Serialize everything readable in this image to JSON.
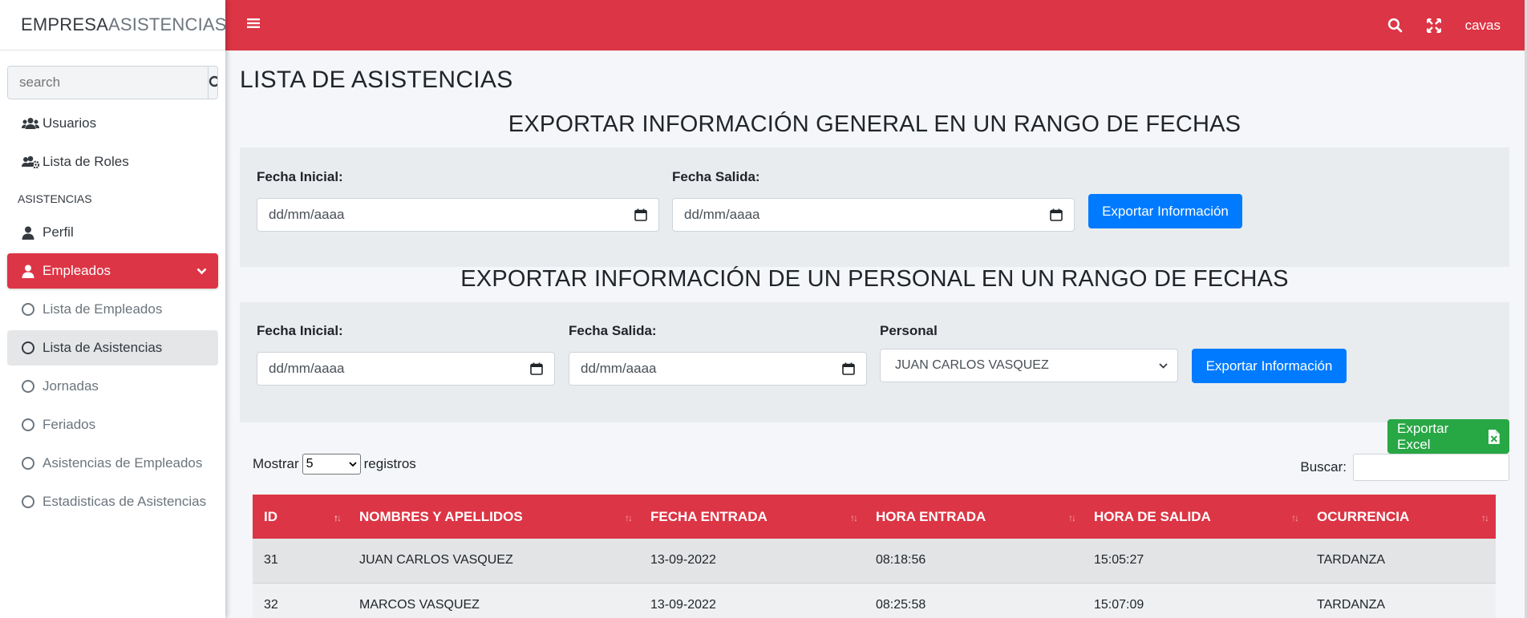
{
  "brand": {
    "bold": "EMPRESA",
    "light": "ASISTENCIAS"
  },
  "sidebar": {
    "search_placeholder": "search",
    "items": [
      {
        "label": "Usuarios",
        "icon": "users-icon"
      },
      {
        "label": "Lista de Roles",
        "icon": "users-cog-icon"
      }
    ],
    "section_header": "ASISTENCIAS",
    "perfil": {
      "label": "Perfil",
      "icon": "user-icon"
    },
    "empleados": {
      "label": "Empleados",
      "icon": "user-icon"
    },
    "subitems": [
      {
        "label": "Lista de Empleados"
      },
      {
        "label": "Lista de Asistencias"
      },
      {
        "label": "Jornadas"
      },
      {
        "label": "Feriados"
      },
      {
        "label": "Asistencias de Empleados"
      },
      {
        "label": "Estadisticas de Asistencias"
      }
    ]
  },
  "topbar": {
    "user": "cavas"
  },
  "page": {
    "title": "LISTA DE ASISTENCIAS",
    "section1": {
      "title": "EXPORTAR INFORMACIÓN GENERAL EN UN RANGO DE FECHAS",
      "fecha_inicial_label": "Fecha Inicial:",
      "fecha_salida_label": "Fecha Salida:",
      "date_placeholder": "dd/mm/aaaa",
      "button": "Exportar Información"
    },
    "section2": {
      "title": "EXPORTAR INFORMACIÓN DE UN PERSONAL EN UN RANGO DE FECHAS",
      "fecha_inicial_label": "Fecha Inicial:",
      "fecha_salida_label": "Fecha Salida:",
      "personal_label": "Personal",
      "personal_value": "JUAN CARLOS VASQUEZ",
      "date_placeholder": "dd/mm/aaaa",
      "button": "Exportar Información"
    },
    "export_excel": "Exportar Excel",
    "table_controls": {
      "mostrar": "Mostrar",
      "length_value": "5",
      "registros": "registros",
      "buscar": "Buscar:"
    },
    "table": {
      "columns": [
        "ID",
        "NOMBRES Y APELLIDOS",
        "FECHA ENTRADA",
        "HORA ENTRADA",
        "HORA DE SALIDA",
        "OCURRENCIA"
      ],
      "rows": [
        [
          "31",
          "JUAN CARLOS VASQUEZ",
          "13-09-2022",
          "08:18:56",
          "15:05:27",
          "TARDANZA"
        ],
        [
          "32",
          "MARCOS VASQUEZ",
          "13-09-2022",
          "08:25:58",
          "15:07:09",
          "TARDANZA"
        ]
      ]
    }
  },
  "colors": {
    "primary_red": "#dc3545",
    "blue": "#007bff",
    "green": "#28a745"
  }
}
